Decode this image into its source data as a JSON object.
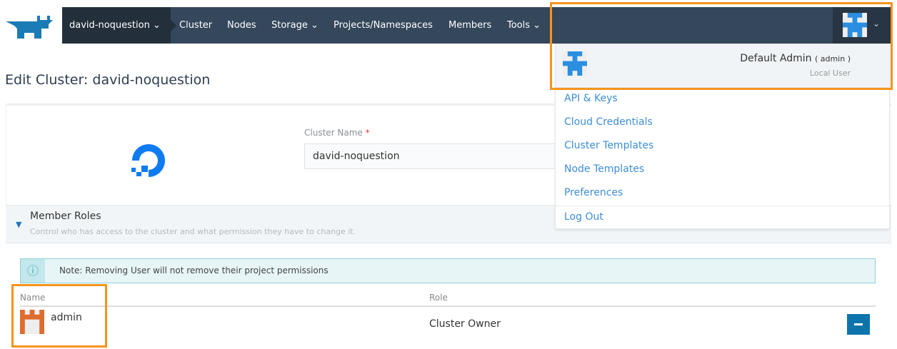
{
  "nav": {
    "cluster": "david-noquestion",
    "items": [
      "Cluster",
      "Nodes",
      "Storage",
      "Projects/Namespaces",
      "Members",
      "Tools"
    ]
  },
  "page": {
    "title": "Edit Cluster: david-noquestion"
  },
  "form": {
    "cluster_name_label": "Cluster Name",
    "required": "*",
    "cluster_name_value": "david-noquestion"
  },
  "roles": {
    "title": "Member Roles",
    "subtitle": "Control who has access to the cluster and what permission they have to change it.",
    "note": "Note: Removing User will not remove their project permissions",
    "columns": [
      "Name",
      "Role"
    ],
    "rows": [
      {
        "name": "admin",
        "role": "Cluster Owner"
      }
    ]
  },
  "user_menu": {
    "name": "Default Admin",
    "username": "( admin )",
    "type": "Local User",
    "items": [
      "API & Keys",
      "Cloud Credentials",
      "Cluster Templates",
      "Node Templates",
      "Preferences",
      "Log Out"
    ]
  },
  "colors": {
    "nav": "#34475b",
    "accent": "#3d8ed6",
    "highlight": "#f7941d"
  }
}
